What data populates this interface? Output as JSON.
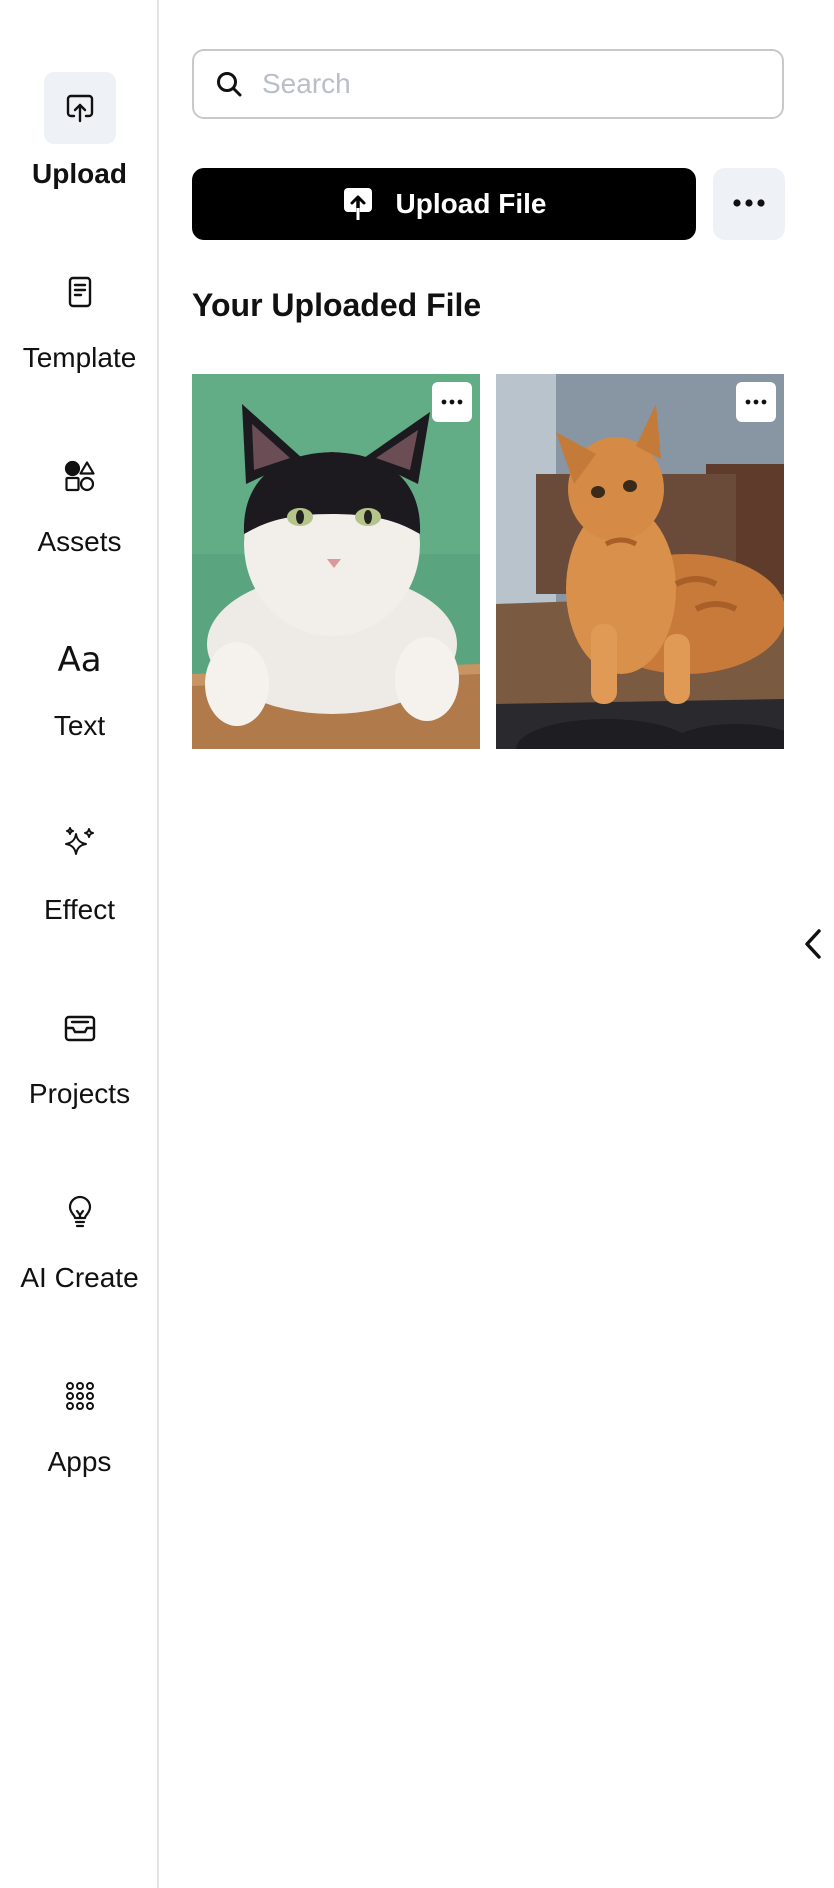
{
  "sidebar": {
    "items": [
      {
        "label": "Upload",
        "icon": "upload-icon",
        "active": true
      },
      {
        "label": "Template",
        "icon": "template-icon"
      },
      {
        "label": "Assets",
        "icon": "assets-icon"
      },
      {
        "label": "Text",
        "icon": "text-icon"
      },
      {
        "label": "Effect",
        "icon": "sparkles-icon"
      },
      {
        "label": "Projects",
        "icon": "inbox-icon"
      },
      {
        "label": "AI Create",
        "icon": "lightbulb-icon"
      },
      {
        "label": "Apps",
        "icon": "grid-dots-icon"
      }
    ],
    "text_icon_glyph": "Aa"
  },
  "search": {
    "placeholder": "Search",
    "value": ""
  },
  "upload": {
    "button_label": "Upload File"
  },
  "section": {
    "title": "Your Uploaded File"
  },
  "files": [
    {
      "subject": "black-and-white cat on green background"
    },
    {
      "subject": "orange tabby cat lying on wooden table"
    }
  ],
  "colors": {
    "accent": "#000000",
    "active_bg": "#eef1f6",
    "placeholder": "#b9bec7"
  }
}
